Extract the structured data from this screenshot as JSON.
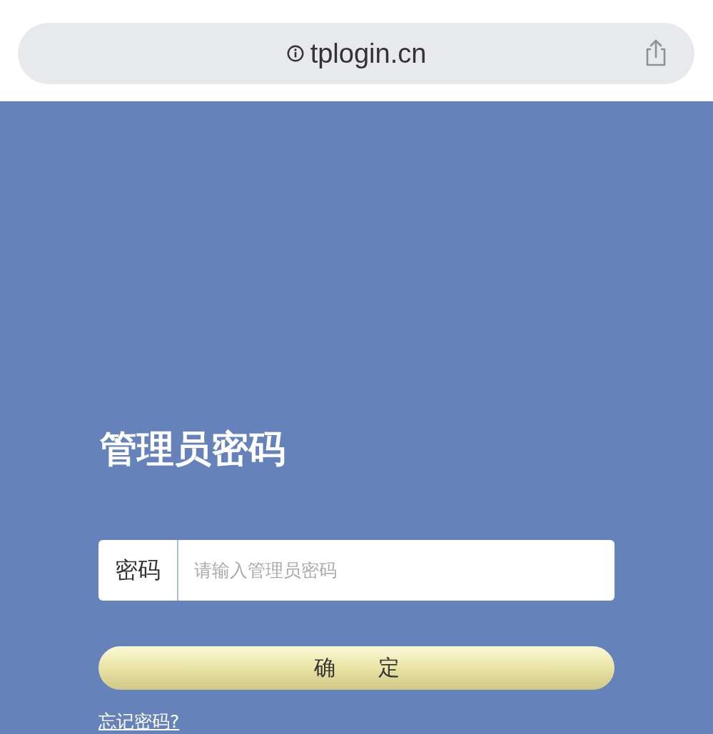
{
  "address_bar": {
    "url": "tplogin.cn"
  },
  "login": {
    "title": "管理员密码",
    "password_label": "密码",
    "password_placeholder": "请输入管理员密码",
    "submit": "确　　定",
    "forgot_link": "忘记密码?"
  }
}
